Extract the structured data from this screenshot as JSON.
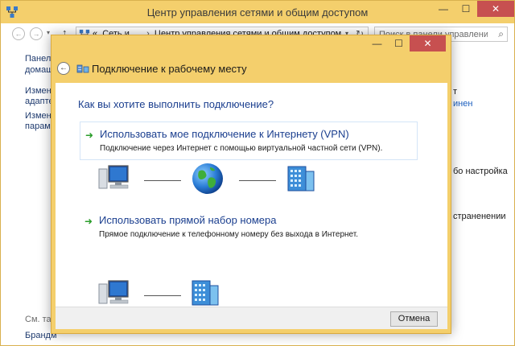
{
  "background_window": {
    "title": "Центр управления сетями и общим доступом",
    "breadcrumb": [
      "«",
      "Сеть и ...",
      "›",
      "Центр управления сетями и общим доступом"
    ],
    "search_placeholder": "Поиск в панели управления",
    "sidebar_fragments": [
      "Панель",
      "домаш",
      "Измене",
      "адаптер",
      "Измене",
      "параме",
      "См. так",
      "Брандм"
    ],
    "right_fragments": [
      "т",
      "инен",
      "бо настройка",
      "страненении"
    ]
  },
  "dialog": {
    "title": "Подключение к рабочему месту",
    "question": "Как вы хотите выполнить подключение?",
    "options": [
      {
        "title": "Использовать мое подключение к Интернету (VPN)",
        "description": "Подключение через Интернет с помощью виртуальной частной сети (VPN)."
      },
      {
        "title": "Использовать прямой набор номера",
        "description": "Прямое подключение к телефонному номеру без выхода в Интернет."
      }
    ],
    "cancel_label": "Отмена"
  },
  "colors": {
    "titlebar": "#f4cf6c",
    "link_blue": "#1b3f8f",
    "close_red": "#c75050",
    "arrow_green": "#2a9d2a"
  },
  "icons": [
    "computer-icon",
    "globe-icon",
    "server-icon",
    "network-icon",
    "back-arrow-icon",
    "green-arrow-icon"
  ]
}
